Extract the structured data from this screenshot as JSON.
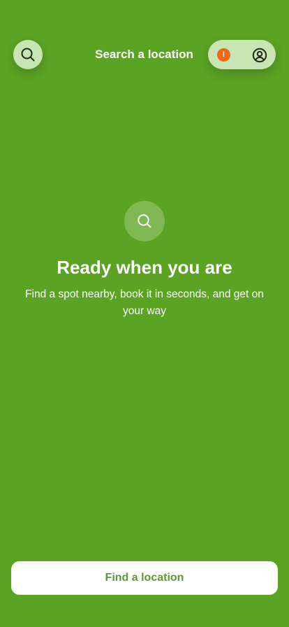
{
  "header": {
    "title": "Search a location",
    "search_icon": "search-icon",
    "alert_icon": "alert-icon",
    "alert_glyph": "!",
    "account_icon": "user-circle-icon"
  },
  "empty_state": {
    "icon": "search-icon",
    "title": "Ready when you are",
    "description": "Find a spot nearby, book it in seconds, and get on your way"
  },
  "footer": {
    "button_label": "Find a location"
  },
  "colors": {
    "background": "#5ba323",
    "pill_background": "#c7e6b3",
    "alert": "#f0670f",
    "button_text": "#5c9a34",
    "icon_dark": "#1f2a18"
  }
}
